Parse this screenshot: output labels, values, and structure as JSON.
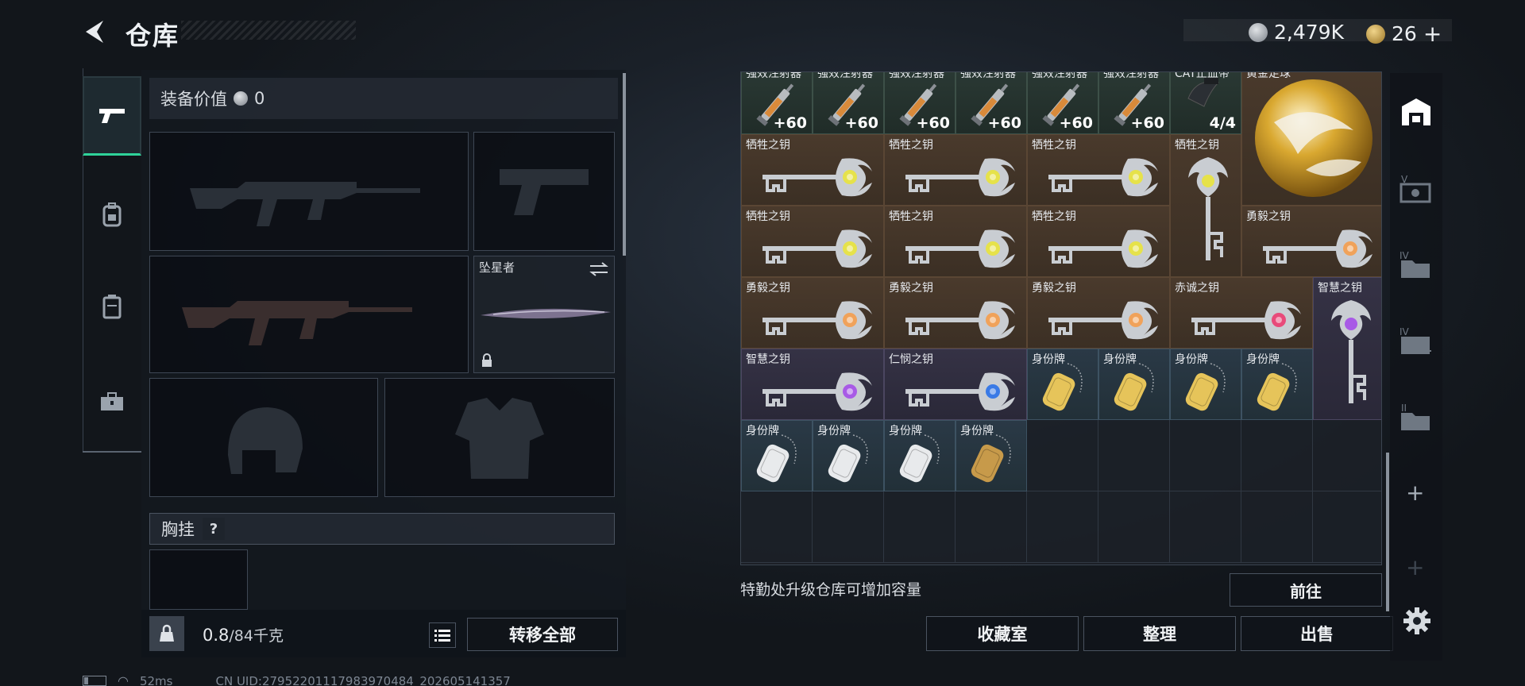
{
  "header": {
    "title": "仓库",
    "currency": {
      "silver": "2,479K",
      "gold": "26"
    }
  },
  "left": {
    "tabs": [
      {
        "icon": "pistol-icon"
      },
      {
        "icon": "backpack-icon"
      },
      {
        "icon": "vest-icon"
      },
      {
        "icon": "toolbox-icon"
      }
    ],
    "equip_value_label": "装备价值",
    "equip_value": "0",
    "melee_name": "坠星者",
    "chest_label": "胸挂",
    "chest_help": "?",
    "weight_value": "0.8",
    "weight_max": "/84千克",
    "transfer_label": "转移全部"
  },
  "grid": {
    "top_row": [
      {
        "label": "强效注射器",
        "count": "+60"
      },
      {
        "label": "强效注射器",
        "count": "+60"
      },
      {
        "label": "强效注射器",
        "count": "+60"
      },
      {
        "label": "强效注射器",
        "count": "+60"
      },
      {
        "label": "强效注射器",
        "count": "+60"
      },
      {
        "label": "强效注射器",
        "count": "+60"
      },
      {
        "label": "CAT止血带",
        "count": "4/4"
      },
      {
        "label": "黄金足球",
        "count": ""
      }
    ],
    "keys": [
      {
        "label": "牺牲之钥"
      },
      {
        "label": "牺牲之钥"
      },
      {
        "label": "牺牲之钥"
      },
      {
        "label": "牺牲之钥"
      },
      {
        "label": "牺牲之钥"
      },
      {
        "label": "牺牲之钥"
      },
      {
        "label": "牺牲之钥"
      },
      {
        "label": "勇毅之钥"
      },
      {
        "label": "勇毅之钥"
      },
      {
        "label": "勇毅之钥"
      },
      {
        "label": "勇毅之钥"
      },
      {
        "label": "赤诚之钥"
      },
      {
        "label": "智慧之钥"
      },
      {
        "label": "智慧之钥"
      },
      {
        "label": "仁悯之钥"
      }
    ],
    "tags": [
      {
        "label": "身份牌"
      },
      {
        "label": "身份牌"
      },
      {
        "label": "身份牌"
      },
      {
        "label": "身份牌"
      },
      {
        "label": "身份牌"
      },
      {
        "label": "身份牌"
      },
      {
        "label": "身份牌"
      },
      {
        "label": "身份牌"
      }
    ],
    "colors": {
      "bronze": "#4a3a2c",
      "purple": "#353245",
      "blue": "#2a3946"
    }
  },
  "footer": {
    "hint": "特勤处升级仓库可增加容量",
    "goto": "前往",
    "collection": "收藏室",
    "sort": "整理",
    "sell": "出售"
  },
  "status": {
    "ping": "52ms",
    "uid": "CN UID:2795220111798397048‌4_202605141357"
  },
  "sidebar": {
    "icons": [
      "warehouse-icon",
      "slot-v-icon",
      "slot-iv-icon",
      "slot-iv2-icon",
      "slot-ii-icon",
      "add-icon",
      "add-disabled-icon",
      "settings-icon"
    ]
  }
}
